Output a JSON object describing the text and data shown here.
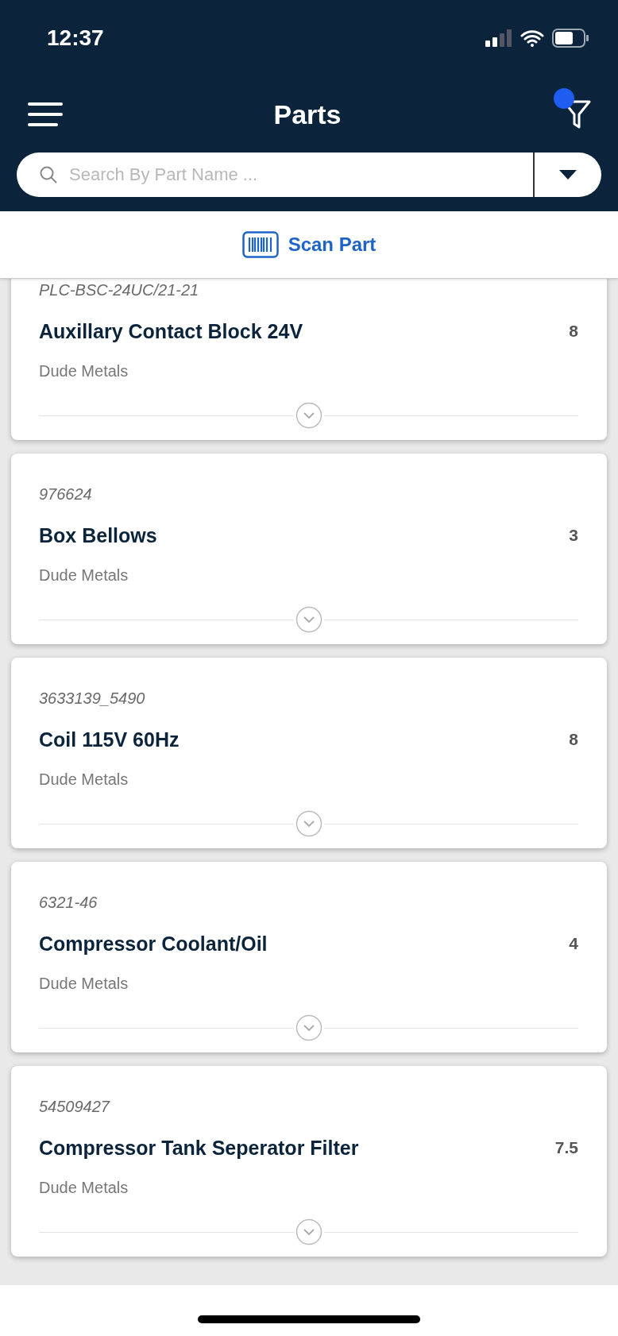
{
  "status_bar": {
    "time": "12:37"
  },
  "header": {
    "title": "Parts",
    "filter": {
      "active": true
    }
  },
  "search": {
    "placeholder": "Search By Part Name ..."
  },
  "scan_button": {
    "label": "Scan Part"
  },
  "parts": [
    {
      "number": "PLC-BSC-24UC/21-21",
      "name": "Auxillary Contact Block 24V",
      "quantity": "8",
      "vendor": "Dude Metals"
    },
    {
      "number": "976624",
      "name": "Box Bellows",
      "quantity": "3",
      "vendor": "Dude Metals"
    },
    {
      "number": "3633139_5490",
      "name": "Coil 115V 60Hz",
      "quantity": "8",
      "vendor": "Dude Metals"
    },
    {
      "number": "6321-46",
      "name": "Compressor Coolant/Oil",
      "quantity": "4",
      "vendor": "Dude Metals"
    },
    {
      "number": "54509427",
      "name": "Compressor Tank Seperator Filter",
      "quantity": "7.5",
      "vendor": "Dude Metals"
    }
  ]
}
